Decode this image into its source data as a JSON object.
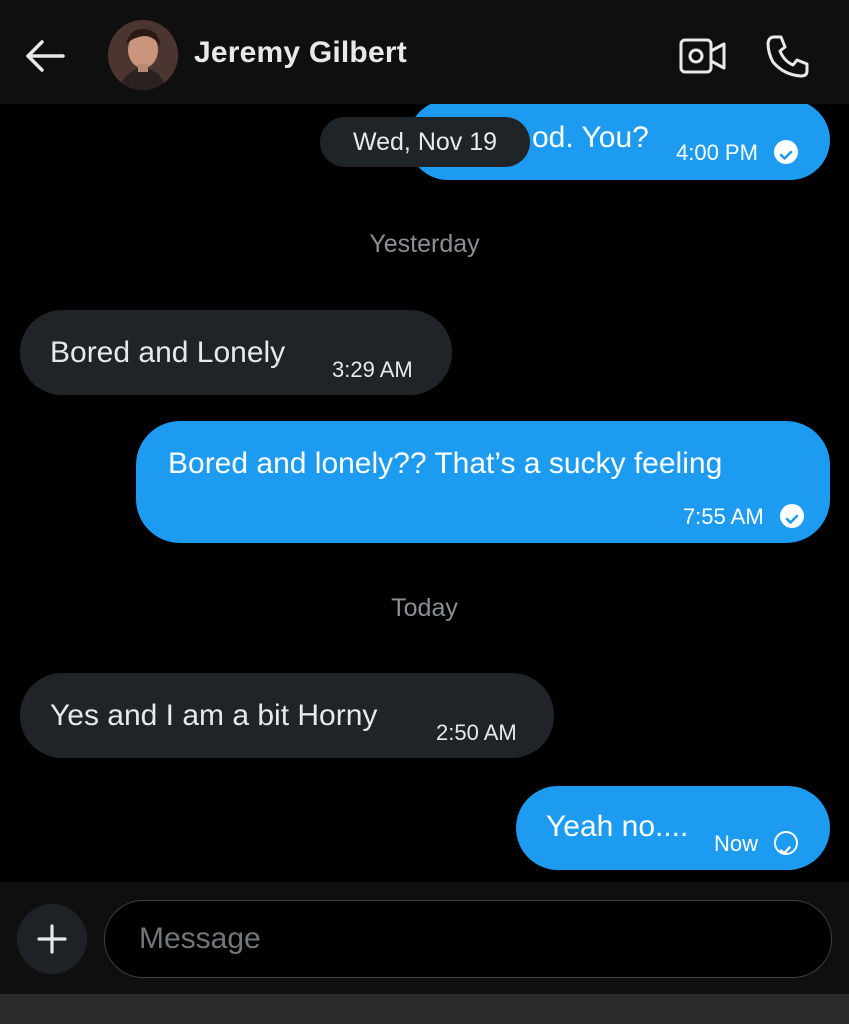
{
  "header": {
    "contact_name": "Jeremy Gilbert",
    "back_icon": "arrow-left-icon",
    "video_icon": "video-camera-icon",
    "call_icon": "phone-icon"
  },
  "date_pill": "Wed, Nov 19",
  "separators": {
    "yesterday": "Yesterday",
    "today": "Today"
  },
  "messages": [
    {
      "direction": "sent",
      "text": "od. You?",
      "time": "4:00 PM",
      "status": "read"
    },
    {
      "direction": "received",
      "text": "Bored and Lonely",
      "time": "3:29 AM"
    },
    {
      "direction": "sent",
      "text": "Bored and lonely?? That’s a sucky feeling",
      "time": "7:55 AM",
      "status": "read"
    },
    {
      "direction": "received",
      "text": "Yes and I am a bit Horny",
      "time": "2:50 AM"
    },
    {
      "direction": "sent",
      "text": "Yeah no....",
      "time": "Now",
      "status": "sent"
    }
  ],
  "composer": {
    "placeholder": "Message",
    "add_icon": "plus-icon"
  },
  "colors": {
    "background": "#000000",
    "sent_bubble": "#1d9bf0",
    "received_bubble": "#202327",
    "muted_text": "#8b9096"
  }
}
